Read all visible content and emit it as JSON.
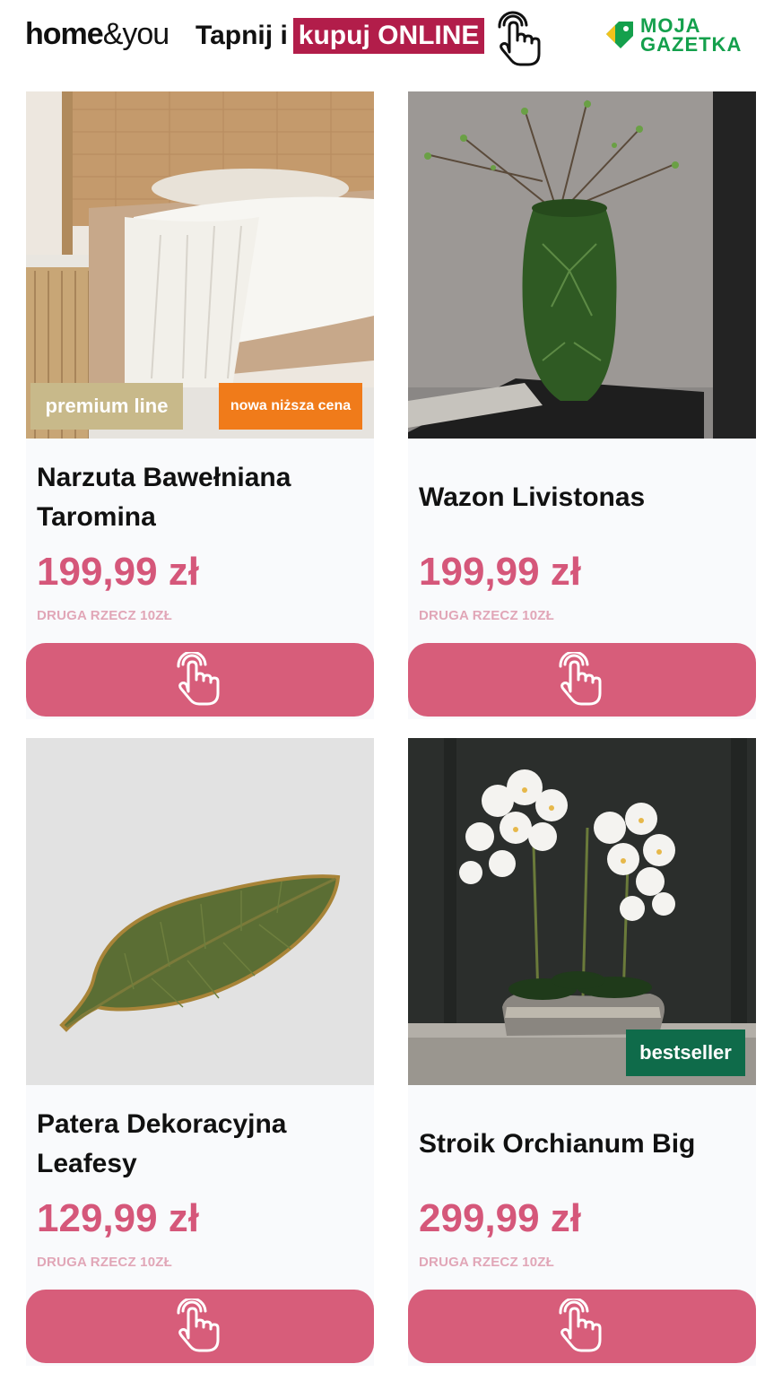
{
  "header": {
    "brand_bold": "home",
    "brand_light": "&you",
    "tagline_prefix": "Tapnij i",
    "tagline_highlight": "kupuj ONLINE",
    "partner_line1": "MOJA",
    "partner_line2": "GAZETKA",
    "icons": [
      "tap-hand-icon",
      "price-tag-icon"
    ]
  },
  "colors": {
    "accent_pink": "#d75d7a",
    "price_pink": "#d5577a",
    "highlight_red": "#b21d4a",
    "partner_green": "#14a04c",
    "badge_premium": "#c8b98a",
    "badge_lower_price": "#f07b1a",
    "badge_bestseller": "#0f6b4a"
  },
  "products": [
    {
      "title": "Narzuta Bawełniana Taromina",
      "price": "199,99 zł",
      "promo": "DRUGA RZECZ 10ZŁ",
      "badges": [
        "premium line",
        "nowa niższa cena"
      ],
      "button_icon": "tap-hand-icon"
    },
    {
      "title": "Wazon Livistonas",
      "price": "199,99 zł",
      "promo": "DRUGA RZECZ 10ZŁ",
      "badges": [],
      "button_icon": "tap-hand-icon"
    },
    {
      "title": "Patera Dekoracyjna Leafesy",
      "price": "129,99 zł",
      "promo": "DRUGA RZECZ 10ZŁ",
      "badges": [],
      "button_icon": "tap-hand-icon"
    },
    {
      "title": "Stroik Orchianum Big",
      "price": "299,99 zł",
      "promo": "DRUGA RZECZ 10ZŁ",
      "badges": [
        "bestseller"
      ],
      "button_icon": "tap-hand-icon"
    }
  ]
}
